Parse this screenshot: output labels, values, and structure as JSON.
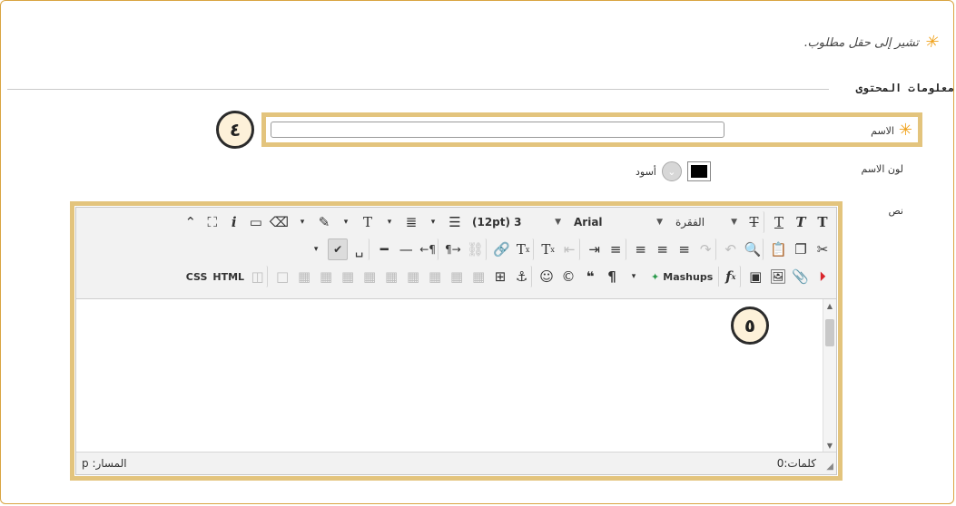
{
  "required_note": "تشير إلى حقل مطلوب.",
  "section_title": "معلومات المحتوى",
  "fields": {
    "name_label": "الاسم",
    "name_value": "",
    "name_color_label": "لون الاسم",
    "color_value_text": "أسود",
    "text_label": "نص"
  },
  "callouts": {
    "name_field": "٤",
    "editor": "٥"
  },
  "editor": {
    "paragraph_label": "الفقرة",
    "font_label": "Arial",
    "size_label": "(12pt) 3",
    "mashups_label": "Mashups",
    "css_label": "CSS",
    "html_label": "HTML",
    "path_text": "المسار: p",
    "word_count_text": "كلمات:0"
  },
  "colors": {
    "accent": "#f0a21b",
    "callout_border": "#e3c47d",
    "callout_fill": "#fdf1d9",
    "name_color": "#000000"
  }
}
